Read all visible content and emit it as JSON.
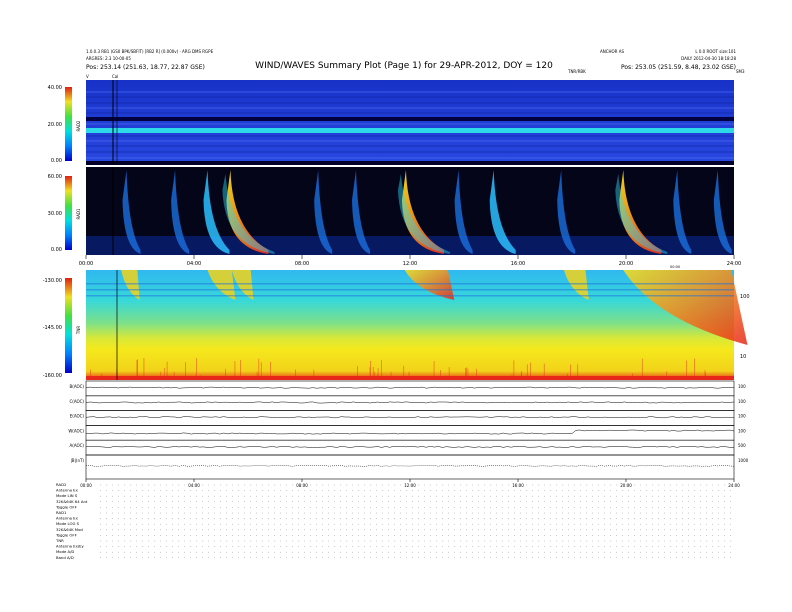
{
  "header": {
    "title": "WIND/WAVES Summary Plot (Page 1) for 29-APR-2012, DOY = 120",
    "left_line1": "1.0.0.3  RB1 (GS0 BPK/SBFIT) [RB2 R] (0.000v)  · ARG DMS RGPE",
    "left_line2": "ARGRES: 2.3 10-00-05",
    "left_pos": "Pos:   253.14 (251.63, 18.77, 22.87 GSE)",
    "right_line1": "ANCHOR AS",
    "right_line2": "L 0.0 ROOT size:101",
    "right_line3": "DAILY   2012-04-30 18:18:28",
    "right_pos": "Pos:   253.05 (251.59, 8.48, 23.02 GSE)",
    "titlebar_small": "TNR/RBK",
    "rb_corner_left": "V",
    "rb_corner_mid": "Cal",
    "rb_corner_right": "SM3"
  },
  "colors": {
    "rb_bg": "#1f3fd6",
    "low_black": "#000000",
    "tnr_bg": "#3fd6d0",
    "burst_red": "#e8261a",
    "burst_yellow": "#f7e11a",
    "line_black": "#000000"
  },
  "chart_data": [
    {
      "type": "heatmap",
      "panel": "RAD2",
      "ylabel": "RAD2",
      "yticks": [
        "40.00",
        "20.00",
        "0.00"
      ],
      "ylim": [
        0,
        40
      ],
      "xlim_hours": [
        0,
        24
      ]
    },
    {
      "type": "heatmap",
      "panel": "RAD1",
      "ylabel": "RAD1",
      "yticks": [
        "60.00",
        "30.00",
        "0.00"
      ],
      "ylim": [
        0,
        60
      ],
      "xticks": [
        "00:00",
        "04:00",
        "08:00",
        "12:00",
        "16:00",
        "20:00",
        "24:00"
      ],
      "xtick_hours": [
        0,
        4,
        8,
        12,
        16,
        20,
        24
      ],
      "bursts": [
        {
          "start_hour": 5.35,
          "intensity": "high"
        },
        {
          "start_hour": 11.85,
          "intensity": "high"
        },
        {
          "start_hour": 19.9,
          "intensity": "high"
        },
        {
          "start_hour": 4.5,
          "intensity": "medium"
        },
        {
          "start_hour": 15.1,
          "intensity": "medium"
        },
        {
          "start_hour": 1.5,
          "intensity": "low"
        },
        {
          "start_hour": 3.3,
          "intensity": "low"
        },
        {
          "start_hour": 8.6,
          "intensity": "low"
        },
        {
          "start_hour": 10.0,
          "intensity": "low"
        },
        {
          "start_hour": 13.8,
          "intensity": "low"
        },
        {
          "start_hour": 17.6,
          "intensity": "low"
        },
        {
          "start_hour": 21.9,
          "intensity": "low"
        },
        {
          "start_hour": 23.4,
          "intensity": "low"
        }
      ]
    },
    {
      "type": "heatmap",
      "panel": "TNR",
      "ylabel": "TNR",
      "yticks": [
        "-130.00",
        "-145.00",
        "-160.00"
      ],
      "ylim": [
        -160,
        -130
      ],
      "right_ticks": [
        "100",
        "10"
      ],
      "xticks": [
        "00:00",
        "04:00",
        "08:00",
        "12:00",
        "16:00",
        "20:00",
        "24:00"
      ],
      "xtick_hours": [
        0,
        4,
        8,
        12,
        16,
        20,
        24
      ],
      "xtick_small_label": "00:00"
    },
    {
      "type": "line",
      "panel": "aux",
      "rows": [
        {
          "label": "B(AOC)",
          "right": "100"
        },
        {
          "label": "C(AOC)",
          "right": "100"
        },
        {
          "label": "E(AOC)",
          "right": "100"
        },
        {
          "label": "W(AOC)",
          "right": "100"
        },
        {
          "label": "A(AOC)",
          "right": "500"
        },
        {
          "label": "|B|(nT)",
          "right": "1000"
        }
      ],
      "xticks": [
        "00:00",
        "04:00",
        "08:00",
        "12:00",
        "16:00",
        "20:00",
        "24:00"
      ]
    }
  ],
  "footer": {
    "lines": [
      "RAD2",
      "Antenna  Ex",
      "Mode  LIN S",
      "32K&64K 64 Ant",
      "Toggle  OFF",
      "RAD1",
      "Antenna  Ex",
      "Mode  LOG S",
      "32K&64K Mod",
      "Toggle  OFF",
      "TNR",
      "Antenna  Ex/Ey",
      "Mode  A/D",
      "Band  A/D"
    ]
  }
}
